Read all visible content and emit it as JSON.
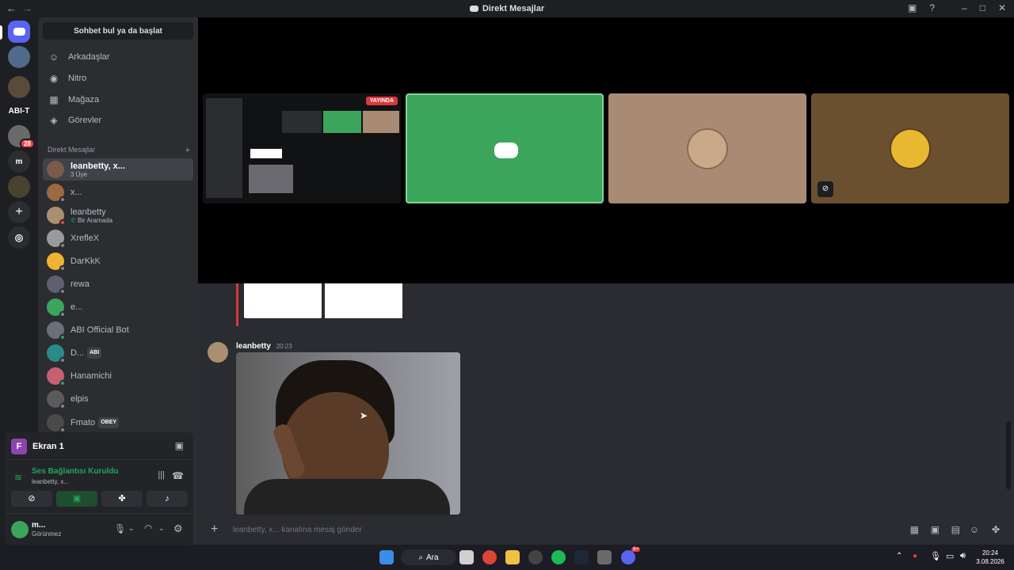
{
  "window": {
    "title": "Direkt Mesajlar"
  },
  "servers": [
    "ABI-T",
    "m",
    "28"
  ],
  "sidebar": {
    "search_label": "Sohbet bul ya da başlat",
    "nav": [
      {
        "label": "Arkadaşlar",
        "icon": "friends-icon"
      },
      {
        "label": "Nitro",
        "icon": "nitro-icon"
      },
      {
        "label": "Mağaza",
        "icon": "shop-icon"
      },
      {
        "label": "Görevler",
        "icon": "quests-icon"
      }
    ],
    "dm_header": "Direkt Mesajlar",
    "dms": [
      {
        "name": "leanbetty, x...",
        "sub": "3 Üye",
        "active": true,
        "color": "#7a5a48"
      },
      {
        "name": "x...",
        "sub": "",
        "color": "#9a6a40"
      },
      {
        "name": "leanbetty",
        "sub": "Bir Aramada",
        "color": "#a89070"
      },
      {
        "name": "XrefleX",
        "sub": "",
        "color": "#9a9a9a"
      },
      {
        "name": "DarKkK",
        "sub": "",
        "color": "#f0b232"
      },
      {
        "name": "rewa",
        "sub": "",
        "color": "#5c6070"
      },
      {
        "name": "e...",
        "sub": "",
        "color": "#3ba55c"
      },
      {
        "name": "ABI Official Bot",
        "sub": "",
        "color": "#6a6f78"
      },
      {
        "name": "D...",
        "sub": "",
        "badge": "ABI",
        "color": "#2a8a8a"
      },
      {
        "name": "Hanamichi",
        "sub": "",
        "color": "#c46070"
      },
      {
        "name": "elpis",
        "sub": "",
        "color": "#5a5a5a"
      },
      {
        "name": "Fmato",
        "sub": "",
        "badge": "OBEY",
        "color": "#4a4a4a"
      }
    ]
  },
  "voice": {
    "stream_title": "Ekran 1",
    "stream_initial": "F",
    "status": "Ses Bağlantısı Kuruldu",
    "channel": "leanbetty, x...",
    "user": {
      "name": "m...",
      "status": "Görünmez"
    }
  },
  "stage": {
    "live_badge": "YAYINDA"
  },
  "chat": {
    "message": {
      "author": "leanbetty",
      "time": "20:23"
    }
  },
  "composer": {
    "placeholder": "leanbetty, x... kanalına mesaj gönder"
  },
  "taskbar": {
    "search": "Ara",
    "time": "20:24",
    "date": "3.08.2026",
    "discord_badge": "9+"
  }
}
